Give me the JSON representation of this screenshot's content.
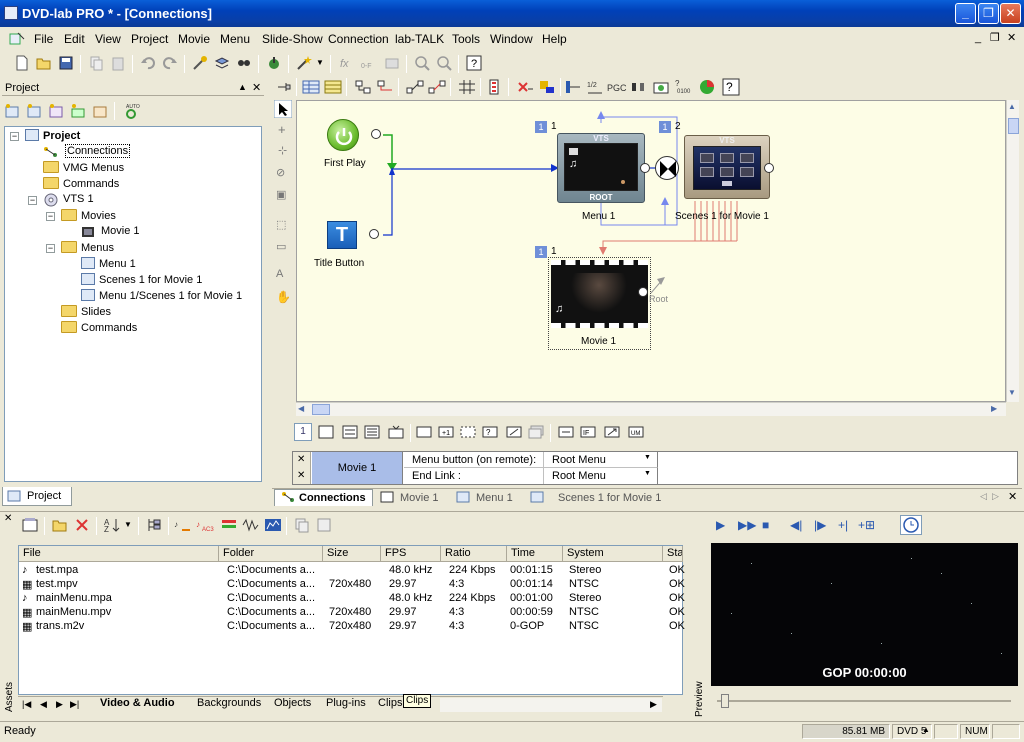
{
  "window": {
    "title": "DVD-lab PRO * - [Connections]",
    "controls": {
      "minimize": "_",
      "maximize": "❐",
      "close": "✕"
    }
  },
  "menubar": {
    "items": [
      "File",
      "Edit",
      "View",
      "Project",
      "Movie",
      "Menu",
      "Slide-Show",
      "Connection",
      "lab-TALK",
      "Tools",
      "Window",
      "Help"
    ]
  },
  "project_panel": {
    "title": "Project",
    "tree": {
      "root": "Project",
      "connections": "Connections",
      "vmg_menus": "VMG Menus",
      "commands_top": "Commands",
      "vts": "VTS 1",
      "movies": "Movies",
      "movie1": "Movie 1",
      "menus": "Menus",
      "menu1": "Menu 1",
      "scenes1": "Scenes 1 for Movie 1",
      "menu1_scenes1": "Menu 1/Scenes 1 for Movie 1",
      "slides": "Slides",
      "commands_vts": "Commands"
    },
    "bottom_tab": "Project"
  },
  "canvas": {
    "first_play": "First Play",
    "title_button": "Title Button",
    "menu1": {
      "label": "Menu 1",
      "badge": "1",
      "num": "1",
      "vts": "VTS",
      "root": "ROOT"
    },
    "scenes": {
      "label": "Scenes 1 for Movie 1",
      "badge": "1",
      "num": "2",
      "vts": "VTS"
    },
    "movie": {
      "label": "Movie 1",
      "badge": "1",
      "num": "1",
      "root_tag": "Root"
    }
  },
  "bottom_toolbar_page": "1",
  "props": {
    "close": "✕",
    "object": "Movie 1",
    "rows": [
      {
        "label": "Menu button (on remote):",
        "value": "Root Menu"
      },
      {
        "label": "End Link :",
        "value": "Root Menu"
      }
    ]
  },
  "doc_tabs": [
    {
      "label": "Connections",
      "active": true
    },
    {
      "label": "Movie 1",
      "active": false
    },
    {
      "label": "Menu 1",
      "active": false
    },
    {
      "label": "Scenes 1 for Movie 1",
      "active": false
    }
  ],
  "assets": {
    "side_label": "Assets",
    "columns": [
      "File",
      "Folder",
      "Size",
      "FPS",
      "Ratio",
      "Time",
      "System",
      "Sta"
    ],
    "rows": [
      {
        "file": "test.mpa",
        "folder": "C:\\Documents a...",
        "size": "",
        "fps": "48.0 kHz",
        "ratio": "224 Kbps",
        "time": "00:01:15",
        "system": "Stereo",
        "status": "OK"
      },
      {
        "file": "test.mpv",
        "folder": "C:\\Documents a...",
        "size": "720x480",
        "fps": "29.97",
        "ratio": "4:3",
        "time": "00:01:14",
        "system": "NTSC",
        "status": "OK"
      },
      {
        "file": "mainMenu.mpa",
        "folder": "C:\\Documents a...",
        "size": "",
        "fps": "48.0 kHz",
        "ratio": "224 Kbps",
        "time": "00:01:00",
        "system": "Stereo",
        "status": "OK"
      },
      {
        "file": "mainMenu.mpv",
        "folder": "C:\\Documents a...",
        "size": "720x480",
        "fps": "29.97",
        "ratio": "4:3",
        "time": "00:00:59",
        "system": "NTSC",
        "status": "OK"
      },
      {
        "file": "trans.m2v",
        "folder": "C:\\Documents a...",
        "size": "720x480",
        "fps": "29.97",
        "ratio": "4:3",
        "time": "0-GOP",
        "system": "NTSC",
        "status": "OK"
      }
    ],
    "tabs": [
      "Video & Audio",
      "Backgrounds",
      "Objects",
      "Plug-ins",
      "Clips"
    ],
    "tooltip": "Clips"
  },
  "preview": {
    "side_label": "Preview",
    "gop": "GOP 00:00:00"
  },
  "status": {
    "ready": "Ready",
    "memory": "85.81 MB",
    "dvd": "DVD 5",
    "num": "NUM"
  }
}
